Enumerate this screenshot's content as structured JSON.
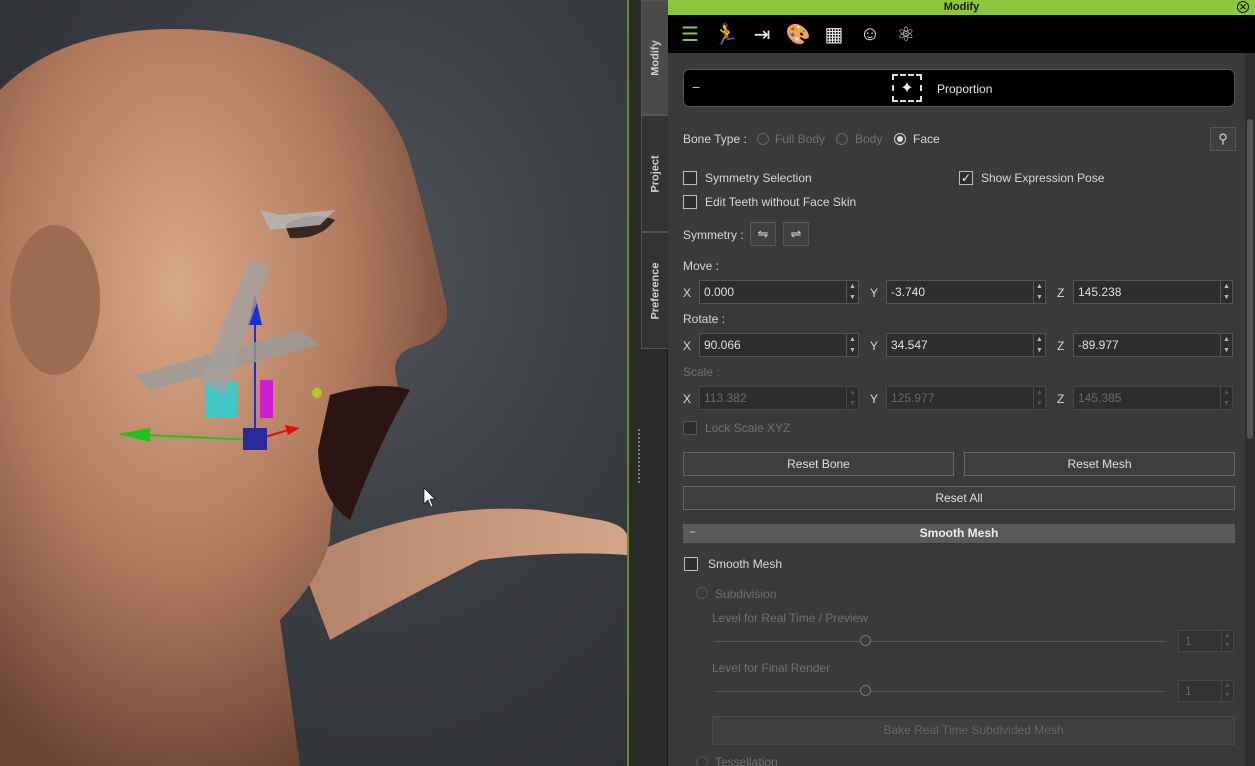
{
  "panel": {
    "title": "Modify",
    "close_icon": "close-circle-icon",
    "accent": "#8cc63f"
  },
  "side_tabs": [
    "Modify",
    "Project",
    "Preference"
  ],
  "toolbar": {
    "icons": [
      "attribute-sliders-icon",
      "motion-icon",
      "morph-icon",
      "material-palette-icon",
      "texture-checker-icon",
      "head-icon",
      "physics-atom-icon"
    ]
  },
  "proportion": {
    "label": "Proportion",
    "collapse": "−"
  },
  "bone_type": {
    "label": "Bone Type :",
    "options": [
      "Full Body",
      "Body",
      "Face"
    ],
    "selected": "Face"
  },
  "checks": {
    "symmetry_selection": {
      "label": "Symmetry Selection",
      "checked": false
    },
    "show_expression_pose": {
      "label": "Show Expression Pose",
      "checked": true
    },
    "edit_teeth": {
      "label": "Edit Teeth without Face Skin",
      "checked": false
    }
  },
  "symmetry": {
    "label": "Symmetry :"
  },
  "move": {
    "label": "Move :",
    "x": "0.000",
    "y": "-3.740",
    "z": "145.238"
  },
  "rotate": {
    "label": "Rotate :",
    "x": "90.066",
    "y": "34.547",
    "z": "-89.977"
  },
  "scale": {
    "label": "Scale :",
    "x": "113.382",
    "y": "125.977",
    "z": "145.385"
  },
  "axes": {
    "x": "X",
    "y": "Y",
    "z": "Z"
  },
  "lock_scale": {
    "label": "Lock Scale XYZ",
    "checked": false
  },
  "buttons": {
    "reset_bone": "Reset Bone",
    "reset_mesh": "Reset Mesh",
    "reset_all": "Reset All"
  },
  "smooth_mesh": {
    "header": "Smooth Mesh",
    "collapse": "−",
    "checkbox_label": "Smooth Mesh",
    "subdivision": "Subdivision",
    "level_realtime": "Level for Real Time / Preview",
    "level_realtime_value": "1",
    "level_final": "Level for Final Render",
    "level_final_value": "1",
    "bake_button": "Bake Real Time Subdivided Mesh",
    "tessellation": "Tessellation"
  }
}
